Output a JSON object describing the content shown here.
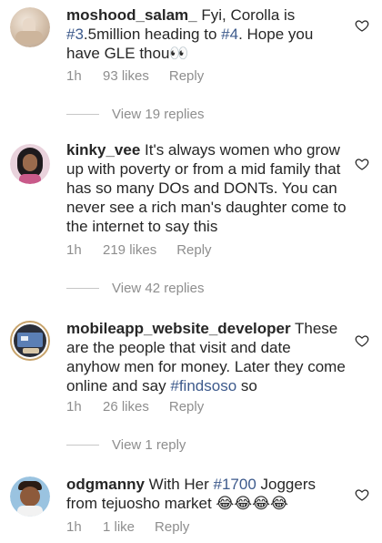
{
  "comments": [
    {
      "username": "moshood_salam_",
      "parts": [
        {
          "t": " Fyi, Corolla is "
        },
        {
          "t": "#3",
          "tag": true
        },
        {
          "t": ".5million heading to "
        },
        {
          "t": "#4",
          "tag": true
        },
        {
          "t": ". Hope you have GLE thou👀"
        }
      ],
      "time": "1h",
      "likes": "93 likes",
      "reply": "Reply",
      "view_replies": "View 19 replies"
    },
    {
      "username": "kinky_vee",
      "parts": [
        {
          "t": " It's always women who grow up with poverty or from a mid family that has so many DOs and DONTs. You can never see a rich man's daughter come to the internet to say this"
        }
      ],
      "time": "1h",
      "likes": "219 likes",
      "reply": "Reply",
      "view_replies": "View 42 replies"
    },
    {
      "username": "mobileapp_website_developer",
      "parts": [
        {
          "t": " These are the people that visit and date anyhow men for money. Later they come online and say "
        },
        {
          "t": "#findsoso",
          "tag": true
        },
        {
          "t": " so"
        }
      ],
      "time": "1h",
      "likes": "26 likes",
      "reply": "Reply",
      "view_replies": "View 1 reply"
    },
    {
      "username": "odgmanny",
      "parts": [
        {
          "t": " With Her "
        },
        {
          "t": "#1700",
          "tag": true
        },
        {
          "t": " Joggers from tejuosho market 😂😂😂😂"
        }
      ],
      "time": "1h",
      "likes": "1 like",
      "reply": "Reply"
    }
  ],
  "colors": {
    "text": "#262626",
    "muted": "#8e8e8e",
    "hashtag": "#3d5a8c"
  },
  "icons": {
    "like": "heart-outline-icon"
  }
}
